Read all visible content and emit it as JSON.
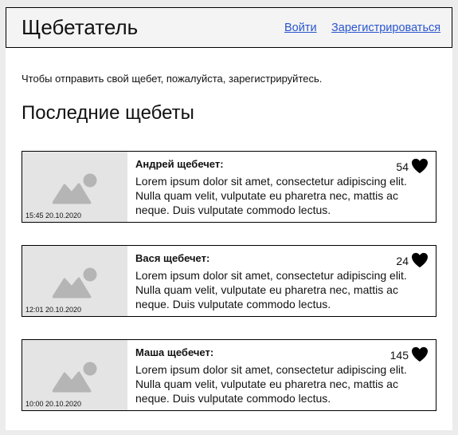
{
  "header": {
    "brand": "Щебетатель",
    "login_label": "Войти",
    "register_label": "Зарегистрироваться"
  },
  "notice": "Чтобы отправить свой щебет, пожалуйста, зарегистрируйтесь.",
  "section_title": "Последние щебеты",
  "tweets": [
    {
      "author": "Андрей щебечет:",
      "text": "Lorem ipsum dolor sit amet, consectetur adipiscing elit. Nulla quam velit, vulputate eu pharetra nec, mattis ac neque. Duis vulputate commodo lectus.",
      "time": "15:45 20.10.2020",
      "likes": "54"
    },
    {
      "author": "Вася щебечет:",
      "text": "Lorem ipsum dolor sit amet, consectetur adipiscing elit. Nulla quam velit, vulputate eu pharetra nec, mattis ac neque. Duis vulputate commodo lectus.",
      "time": "12:01 20.10.2020",
      "likes": "24"
    },
    {
      "author": "Маша щебечет:",
      "text": "Lorem ipsum dolor sit amet, consectetur adipiscing elit. Nulla quam velit, vulputate eu pharetra nec, mattis ac neque. Duis vulputate commodo lectus.",
      "time": "10:00 20.10.2020",
      "likes": "145"
    }
  ],
  "colors": {
    "link": "#2a55d0",
    "image_placeholder": "#e4e4e4",
    "header_bg": "#f4f4f4"
  },
  "icons": {
    "image": "image-placeholder-icon",
    "like": "heart-icon"
  }
}
